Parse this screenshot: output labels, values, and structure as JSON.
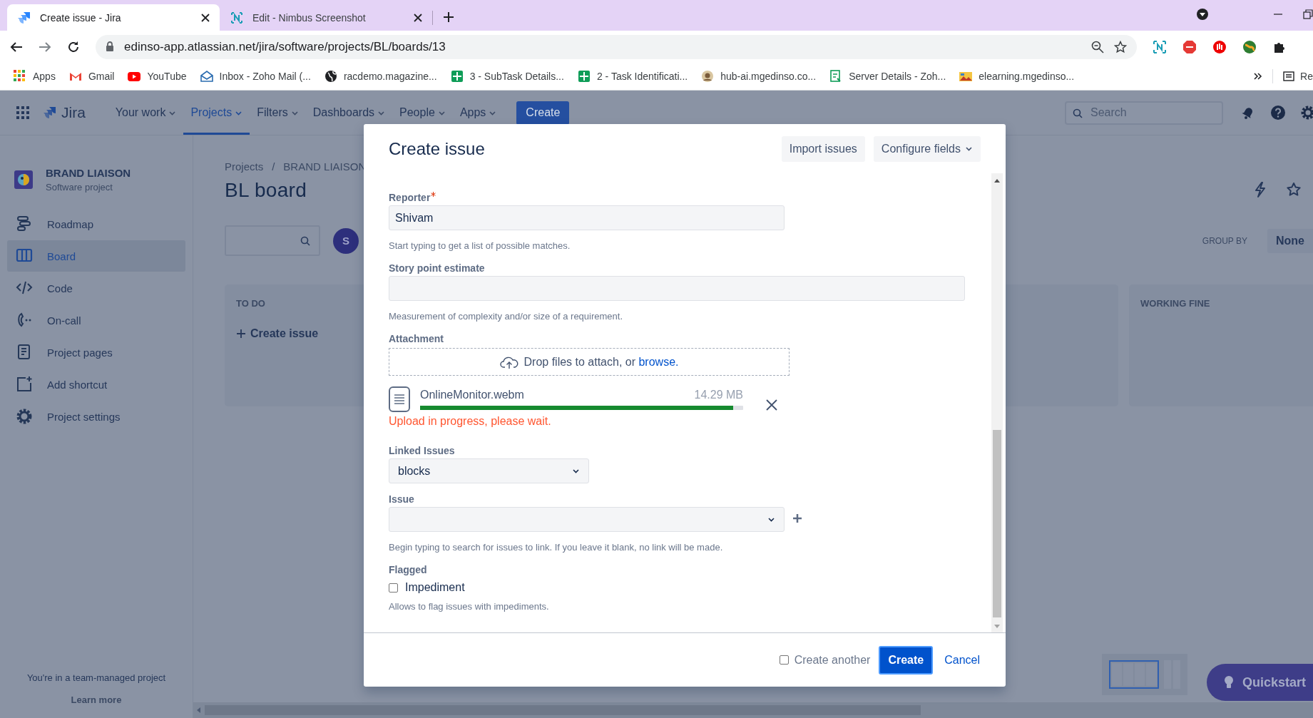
{
  "browser": {
    "tabs": [
      {
        "title": "Create issue - Jira",
        "selected": true
      },
      {
        "title": "Edit - Nimbus Screenshot",
        "selected": false
      }
    ],
    "address": "edinso-app.atlassian.net/jira/software/projects/BL/boards/13",
    "bookmarks": [
      "Apps",
      "Gmail",
      "YouTube",
      "Inbox - Zoho Mail (...",
      "racdemo.magazine...",
      "3 - SubTask Details...",
      "2 - Task Identificati...",
      "hub-ai.mgedinso.co...",
      "Server Details - Zoh...",
      "elearning.mgedinso..."
    ],
    "reading_list": "Re"
  },
  "nav": {
    "product": "Jira",
    "items": [
      {
        "label": "Your work",
        "selected": false
      },
      {
        "label": "Projects",
        "selected": true
      },
      {
        "label": "Filters",
        "selected": false
      },
      {
        "label": "Dashboards",
        "selected": false
      },
      {
        "label": "People",
        "selected": false
      },
      {
        "label": "Apps",
        "selected": false
      }
    ],
    "create": "Create",
    "search": {
      "placeholder": "Search"
    }
  },
  "sidebar": {
    "project_name": "BRAND LIAISON",
    "project_type": "Software project",
    "items": [
      {
        "label": "Roadmap",
        "selected": false
      },
      {
        "label": "Board",
        "selected": true
      },
      {
        "label": "Code",
        "selected": false
      },
      {
        "label": "On-call",
        "selected": false
      },
      {
        "label": "Project pages",
        "selected": false
      },
      {
        "label": "Add shortcut",
        "selected": false
      },
      {
        "label": "Project settings",
        "selected": false
      }
    ],
    "footer": "You're in a team-managed project",
    "footer_link": "Learn more"
  },
  "board": {
    "breadcrumbs": [
      "Projects",
      "BRAND LIAISON"
    ],
    "breadcrumb_separator": "/",
    "title": "BL board",
    "avatar": "S",
    "group_by_label": "GROUP BY",
    "group_by_value": "None",
    "columns": [
      {
        "title": "TO DO",
        "action": "Create issue"
      },
      {
        "title": "WORKING FINE"
      }
    ],
    "quickstart": "Quickstart"
  },
  "modal": {
    "title": "Create issue",
    "header_buttons": [
      "Import issues",
      "Configure fields"
    ],
    "reporter": {
      "label": "Reporter",
      "required": true,
      "value": "Shivam",
      "hint": "Start typing to get a list of possible matches."
    },
    "story_points": {
      "label": "Story point estimate",
      "hint": "Measurement of complexity and/or size of a requirement."
    },
    "attachment": {
      "label": "Attachment",
      "drop_text": "Drop files to attach, or",
      "drop_link": "browse.",
      "file": {
        "name": "OnlineMonitor.webm",
        "size": "14.29 MB",
        "level": 0.97
      },
      "error": "Upload in progress, please wait."
    },
    "linked_issues": {
      "label": "Linked Issues",
      "value": "blocks"
    },
    "issue": {
      "label": "Issue",
      "hint": "Begin typing to search for issues to link. If you leave it blank, no link will be made."
    },
    "flagged": {
      "label": "Flagged",
      "option": "Impediment",
      "checked": false,
      "hint": "Allows to flag issues with impediments."
    },
    "footer": {
      "create_another": "Create another",
      "create_another_checked": false,
      "create": "Create",
      "cancel": "Cancel"
    }
  }
}
